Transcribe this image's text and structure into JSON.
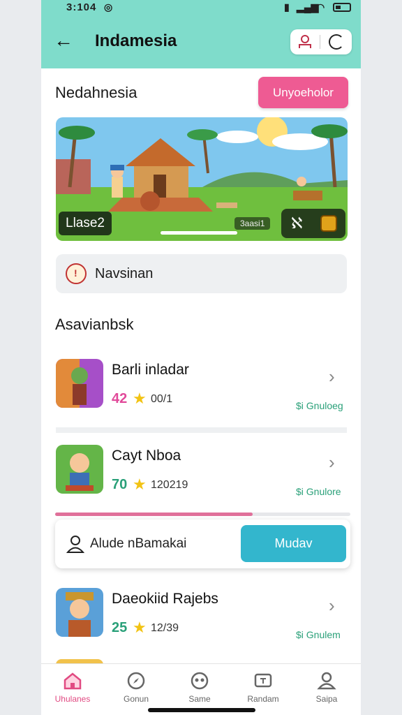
{
  "status": {
    "time": "3:104"
  },
  "header": {
    "title": "Indamesia"
  },
  "section": {
    "title": "Nedahnesia",
    "button": "Unyoeholor"
  },
  "banner": {
    "tag": "Llase2",
    "counter": "3aasi1"
  },
  "nav_card": {
    "label": "Navsinan"
  },
  "list": {
    "heading": "Asavianbsk",
    "items": [
      {
        "name": "Barli inladar",
        "rating": "42",
        "rating_color": "#e14a9a",
        "count": "00/1",
        "price": "$i Gnuloeg"
      },
      {
        "name": "Cayt Nboa",
        "rating": "70",
        "rating_color": "#2aa079",
        "count": "120219",
        "price": "$i Gnulore"
      },
      {
        "name": "Daeokiid Rajebs",
        "rating": "25",
        "rating_color": "#2aa079",
        "count": "12/39",
        "price": "$i Gnulem"
      }
    ]
  },
  "toast": {
    "label": "Alude nBamakai",
    "button": "Mudav",
    "progress": 0.67
  },
  "tabs": [
    {
      "label": "Uhulanes",
      "icon": "home-icon",
      "active": true
    },
    {
      "label": "Gonun",
      "icon": "compass-icon",
      "active": false
    },
    {
      "label": "Same",
      "icon": "game-icon",
      "active": false
    },
    {
      "label": "Randam",
      "icon": "tv-icon",
      "active": false
    },
    {
      "label": "Saipa",
      "icon": "profile-icon",
      "active": false
    }
  ],
  "colors": {
    "header": "#7fdccb",
    "accent_pink": "#ee5b93",
    "accent_teal": "#33b6cd",
    "price_green": "#2aa079"
  }
}
